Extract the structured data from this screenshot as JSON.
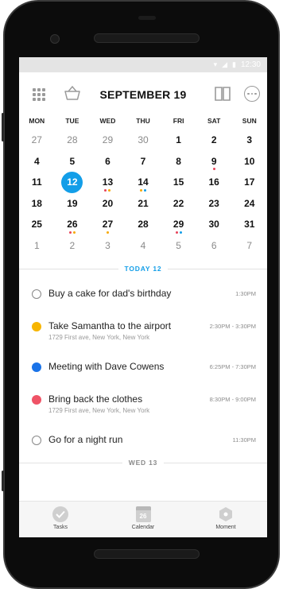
{
  "status_bar": {
    "time": "12:30"
  },
  "header": {
    "month_title": "SEPTEMBER 19"
  },
  "weekdays": [
    "MON",
    "TUE",
    "WED",
    "THU",
    "FRI",
    "SAT",
    "SUN"
  ],
  "calendar_weeks": [
    [
      {
        "d": "27",
        "muted": true
      },
      {
        "d": "28",
        "muted": true
      },
      {
        "d": "29",
        "muted": true
      },
      {
        "d": "30",
        "muted": true
      },
      {
        "d": "1"
      },
      {
        "d": "2"
      },
      {
        "d": "3"
      }
    ],
    [
      {
        "d": "4"
      },
      {
        "d": "5"
      },
      {
        "d": "6"
      },
      {
        "d": "7"
      },
      {
        "d": "8"
      },
      {
        "d": "9",
        "dots": [
          "#e8445a"
        ]
      },
      {
        "d": "10"
      }
    ],
    [
      {
        "d": "11"
      },
      {
        "d": "12",
        "today": true
      },
      {
        "d": "13",
        "dots": [
          "#e8445a",
          "#f7a800"
        ]
      },
      {
        "d": "14",
        "dots": [
          "#f7a800",
          "#139ee8"
        ]
      },
      {
        "d": "15"
      },
      {
        "d": "16"
      },
      {
        "d": "17"
      }
    ],
    [
      {
        "d": "18"
      },
      {
        "d": "19"
      },
      {
        "d": "20"
      },
      {
        "d": "21"
      },
      {
        "d": "22"
      },
      {
        "d": "23"
      },
      {
        "d": "24"
      }
    ],
    [
      {
        "d": "25"
      },
      {
        "d": "26",
        "dots": [
          "#e8445a",
          "#f7a800"
        ]
      },
      {
        "d": "27",
        "dots": [
          "#f7a800"
        ]
      },
      {
        "d": "28"
      },
      {
        "d": "29",
        "dots": [
          "#e8445a",
          "#139ee8"
        ]
      },
      {
        "d": "30"
      },
      {
        "d": "31"
      }
    ],
    [
      {
        "d": "1",
        "muted": true
      },
      {
        "d": "2",
        "muted": true
      },
      {
        "d": "3",
        "muted": true
      },
      {
        "d": "4",
        "muted": true
      },
      {
        "d": "5",
        "muted": true
      },
      {
        "d": "6",
        "muted": true
      },
      {
        "d": "7",
        "muted": true
      }
    ]
  ],
  "sections": {
    "today_label": "TODAY 12",
    "next_label": "WED 13"
  },
  "tasks": [
    {
      "title": "Buy a cake for dad's birthday",
      "sub": "",
      "time": "1:30PM",
      "marker": "empty"
    },
    {
      "title": "Take Samantha to the airport",
      "sub": "1729 First ave, New York, New York",
      "time": "2:30PM - 3:30PM",
      "marker": "#f7b500"
    },
    {
      "title": "Meeting with Dave Cowens",
      "sub": "",
      "time": "6:25PM - 7:30PM",
      "marker": "#1a73e8"
    },
    {
      "title": "Bring back the clothes",
      "sub": "1729 First ave, New York, New York",
      "time": "8:30PM - 9:00PM",
      "marker": "#ef5366"
    },
    {
      "title": "Go for a night run",
      "sub": "",
      "time": "11:30PM",
      "marker": "empty"
    }
  ],
  "tabbar": {
    "tasks_label": "Tasks",
    "calendar_label": "Calendar",
    "calendar_day": "26",
    "moment_label": "Moment"
  },
  "colors": {
    "accent": "#139ee8",
    "today_label": "#139ee8",
    "section_label": "#8a8a8a"
  },
  "icons": [
    "grid-icon",
    "basket-icon",
    "book-icon",
    "more-icon",
    "wifi-icon",
    "signal-icon",
    "battery-icon",
    "check-icon",
    "calendar-icon",
    "hexagon-icon"
  ]
}
